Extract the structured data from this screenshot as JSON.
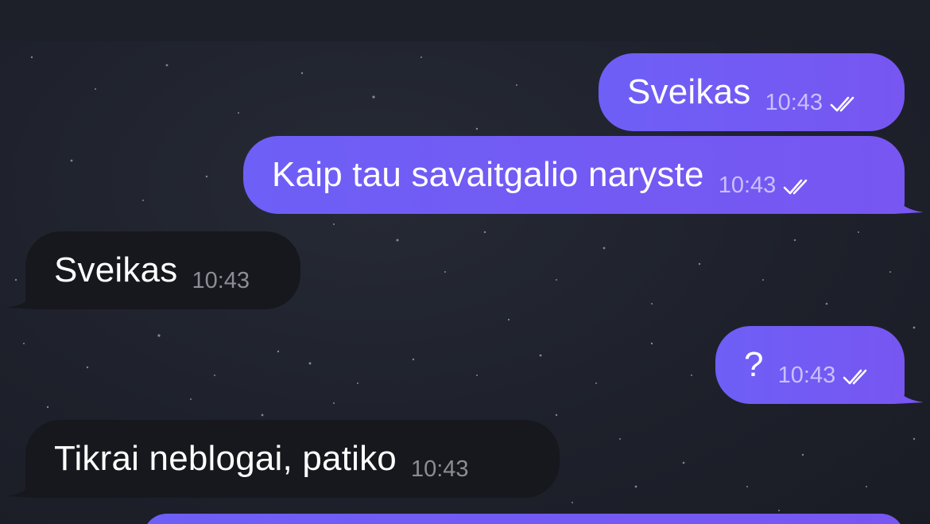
{
  "messages": [
    {
      "direction": "outgoing",
      "text": "Sveikas",
      "time": "10:43",
      "status_icon": "double-check-icon"
    },
    {
      "direction": "outgoing",
      "text": "Kaip tau savaitgalio naryste",
      "time": "10:43",
      "status_icon": "double-check-icon"
    },
    {
      "direction": "incoming",
      "text": "Sveikas",
      "time": "10:43"
    },
    {
      "direction": "outgoing",
      "text": "?",
      "time": "10:43",
      "status_icon": "double-check-icon"
    },
    {
      "direction": "incoming",
      "text": "Tikrai neblogai, patiko",
      "time": "10:43"
    }
  ],
  "colors": {
    "outgoing_bubble": "#7059f4",
    "incoming_bubble": "#17181d",
    "background": "#1e212b"
  }
}
